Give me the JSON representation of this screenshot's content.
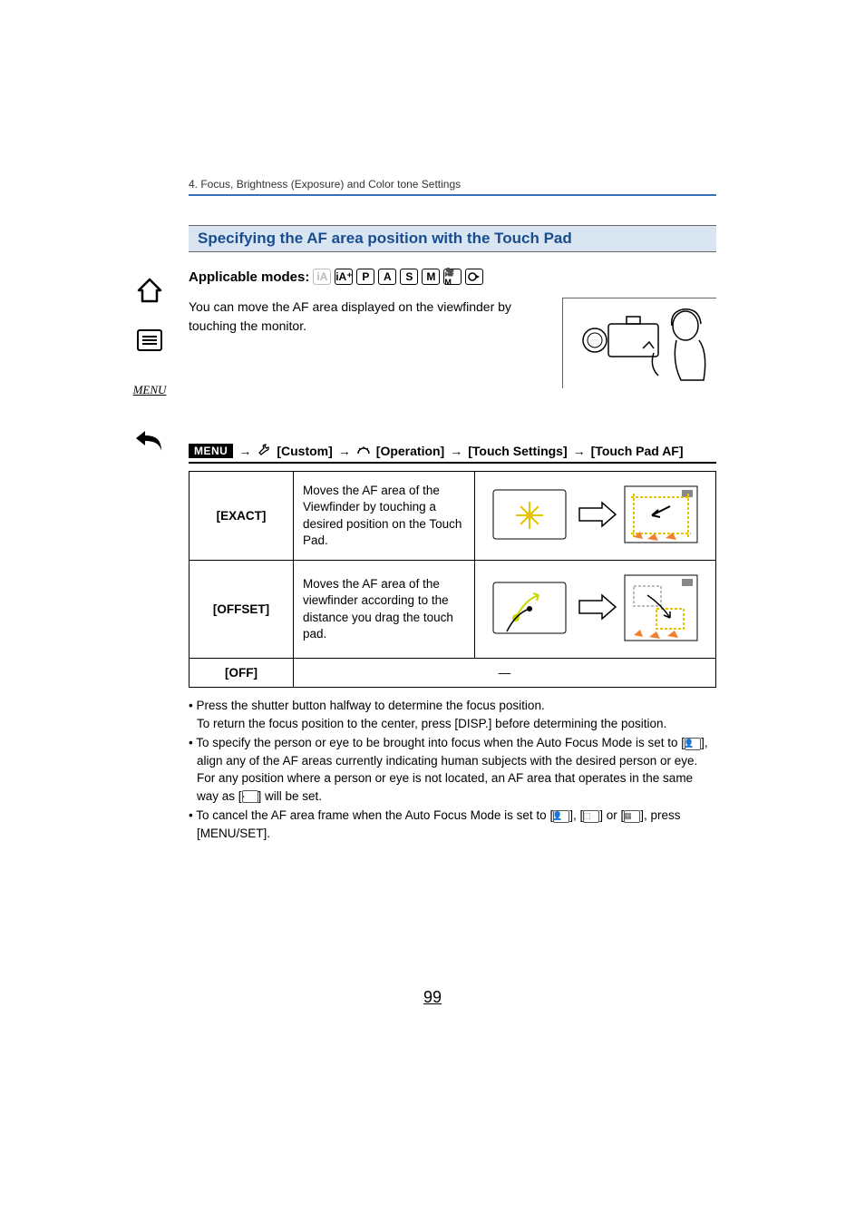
{
  "chapter": "4. Focus, Brightness (Exposure) and Color tone Settings",
  "section_title": "Specifying the AF area position with the Touch Pad",
  "modes_label": "Applicable modes:",
  "modes": [
    "iA",
    "iA+",
    "P",
    "A",
    "S",
    "M",
    "🎥M",
    "C"
  ],
  "intro": "You can move the AF area displayed on the viewfinder by touching the monitor.",
  "menu_path": {
    "menu_label": "MENU",
    "arrow": "→",
    "custom": "[Custom]",
    "operation": "[Operation]",
    "touch_settings": "[Touch Settings]",
    "touch_pad_af": "[Touch Pad AF]"
  },
  "table": {
    "rows": [
      {
        "label": "[EXACT]",
        "desc": "Moves the AF area of the Viewfinder by touching a desired position on the Touch Pad."
      },
      {
        "label": "[OFFSET]",
        "desc": "Moves the AF area of the viewfinder according to the distance you drag the touch pad."
      },
      {
        "label": "[OFF]",
        "desc": "—"
      }
    ]
  },
  "bullets": [
    "Press the shutter button halfway to determine the focus position. To return the focus position to the center, press [DISP.] before determining the position.",
    "To specify the person or eye to be brought into focus when the Auto Focus Mode is set to [face-icon], align any of the AF areas currently indicating human subjects with the desired person or eye. For any position where a person or eye is not located, an AF area that operates in the same way as [area-icon] will be set.",
    "To cancel the AF area frame when the Auto Focus Mode is set to [face-icon], [track-icon] or [multi-icon], press [MENU/SET]."
  ],
  "page_number": "99",
  "sidebar_menu_label": "MENU"
}
